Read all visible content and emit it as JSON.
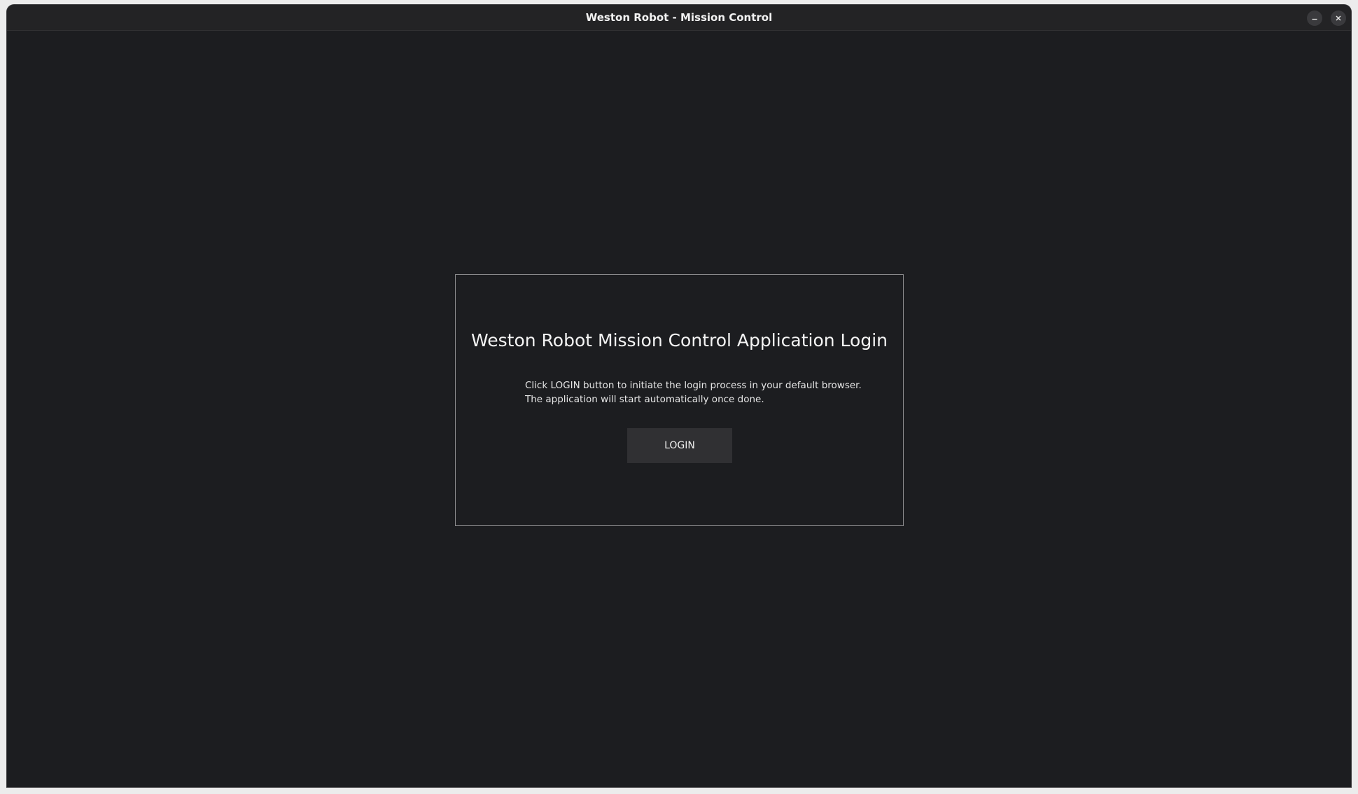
{
  "window": {
    "title": "Weston Robot - Mission Control",
    "controls": {
      "minimize_icon": "minimize-icon",
      "close_icon": "close-icon"
    }
  },
  "login": {
    "heading": "Weston Robot Mission Control Application Login",
    "instruction_line1": "Click LOGIN button to initiate the login process in your default browser.",
    "instruction_line2": "The application will start automatically once done.",
    "button_label": "LOGIN"
  },
  "colors": {
    "background": "#1c1d20",
    "titlebar": "#232325",
    "panel_border": "#8c8c8e",
    "button_background": "#303033",
    "text": "#f4f4f4"
  }
}
